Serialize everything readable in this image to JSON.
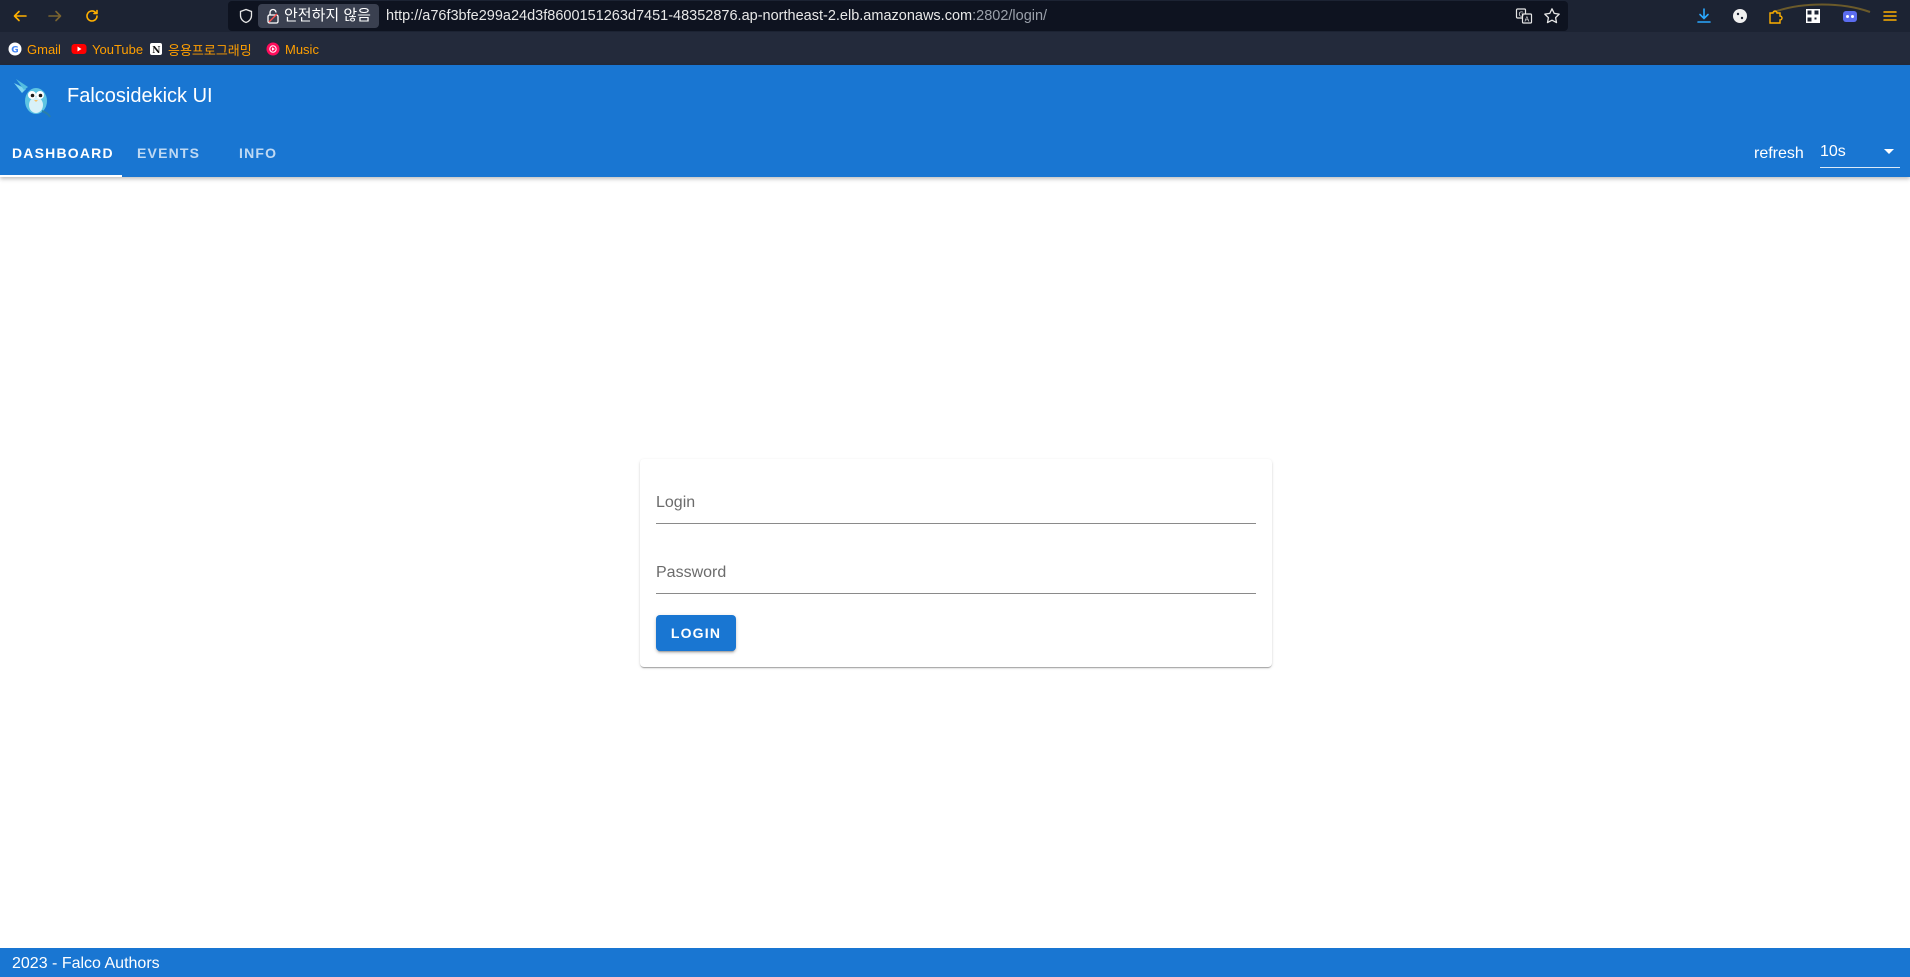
{
  "browser": {
    "security_label": "안전하지 않음",
    "url_main": "http://a76f3bfe299a24d3f8600151263d7451-48352876.ap-northeast-2.elb.amazonaws.com",
    "url_path": ":2802/login/",
    "bookmarks": [
      {
        "label": "Gmail",
        "icon": "google-icon"
      },
      {
        "label": "YouTube",
        "icon": "youtube-icon"
      },
      {
        "label": "응용프로그래밍",
        "icon": "notion-icon"
      },
      {
        "label": "Music",
        "icon": "music-icon"
      }
    ]
  },
  "app": {
    "title": "Falcosidekick UI",
    "tabs": [
      {
        "label": "DASHBOARD",
        "active": true
      },
      {
        "label": "EVENTS",
        "active": false
      },
      {
        "label": "INFO",
        "active": false
      }
    ],
    "refresh_label": "refresh",
    "refresh_value": "10s"
  },
  "login": {
    "login_placeholder": "Login",
    "password_placeholder": "Password",
    "button_label": "LOGIN"
  },
  "footer": {
    "text": "2023 - Falco Authors"
  },
  "colors": {
    "primary": "#1976d2",
    "browser_bg": "#1c2333",
    "bookmark_text": "#ff9f00"
  }
}
